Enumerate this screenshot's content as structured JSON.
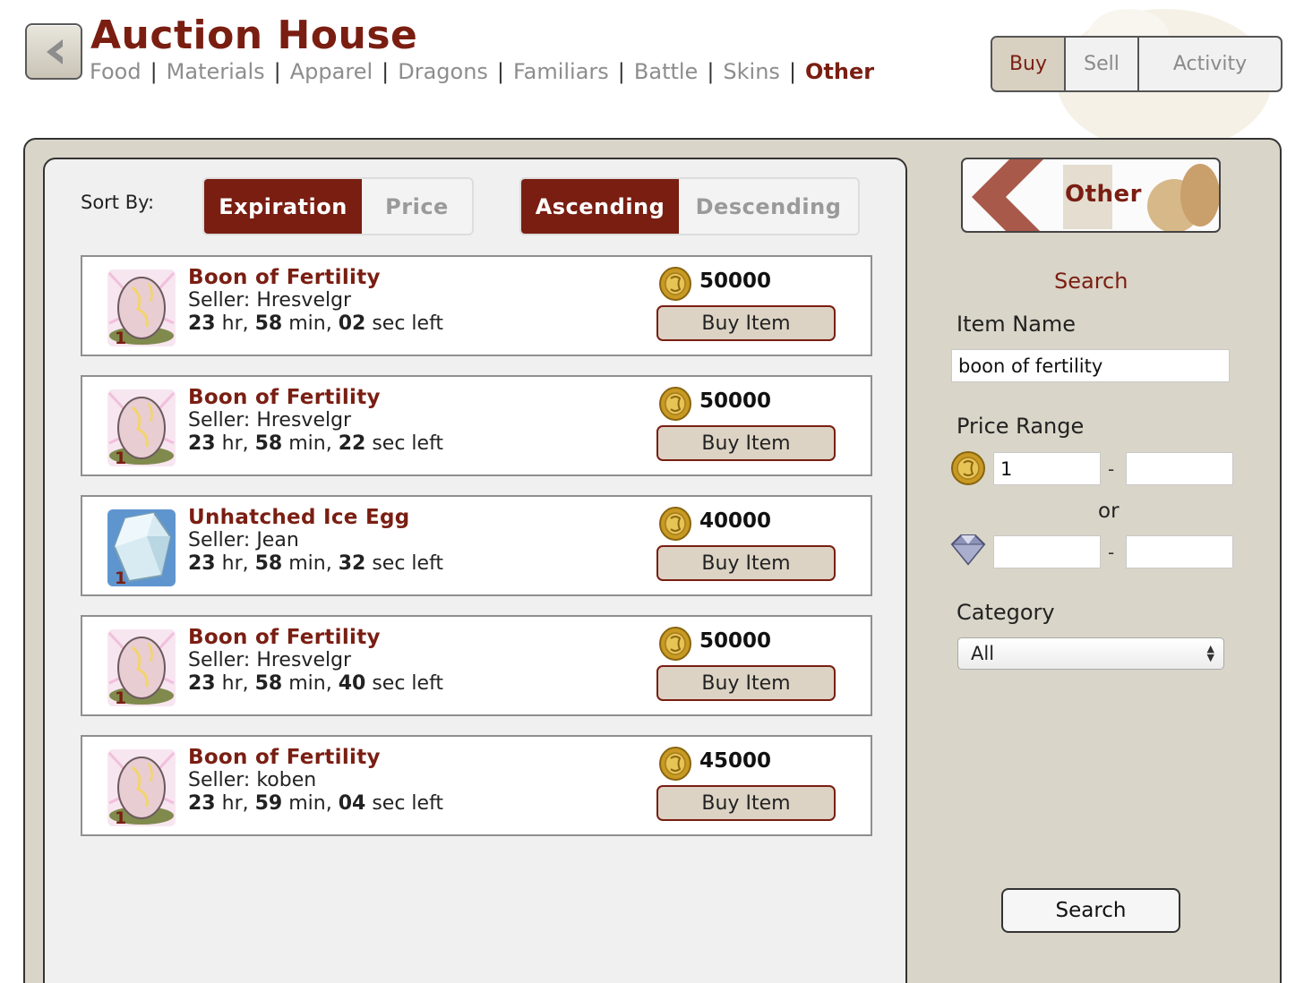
{
  "header": {
    "title": "Auction House",
    "categories": [
      {
        "label": "Food",
        "active": false
      },
      {
        "label": "Materials",
        "active": false
      },
      {
        "label": "Apparel",
        "active": false
      },
      {
        "label": "Dragons",
        "active": false
      },
      {
        "label": "Familiars",
        "active": false
      },
      {
        "label": "Battle",
        "active": false
      },
      {
        "label": "Skins",
        "active": false
      },
      {
        "label": "Other",
        "active": true
      }
    ],
    "separator": "|",
    "modes": [
      {
        "label": "Buy",
        "active": true
      },
      {
        "label": "Sell",
        "active": false
      },
      {
        "label": "Activity",
        "active": false
      }
    ]
  },
  "sort": {
    "label": "Sort By:",
    "field_options": [
      {
        "label": "Expiration",
        "active": true
      },
      {
        "label": "Price",
        "active": false
      }
    ],
    "order_options": [
      {
        "label": "Ascending",
        "active": true
      },
      {
        "label": "Descending",
        "active": false
      }
    ]
  },
  "listings": [
    {
      "name": "Boon of Fertility",
      "seller": "Seller: Hresvelgr",
      "hr": "23",
      "min": "58",
      "sec": "02",
      "price": "50000",
      "qty": "1",
      "icon": "egg-icon",
      "buy_label": "Buy Item"
    },
    {
      "name": "Boon of Fertility",
      "seller": "Seller: Hresvelgr",
      "hr": "23",
      "min": "58",
      "sec": "22",
      "price": "50000",
      "qty": "1",
      "icon": "egg-icon",
      "buy_label": "Buy Item"
    },
    {
      "name": "Unhatched Ice Egg",
      "seller": "Seller: Jean",
      "hr": "23",
      "min": "58",
      "sec": "32",
      "price": "40000",
      "qty": "1",
      "icon": "ice-egg-icon",
      "buy_label": "Buy Item"
    },
    {
      "name": "Boon of Fertility",
      "seller": "Seller: Hresvelgr",
      "hr": "23",
      "min": "58",
      "sec": "40",
      "price": "50000",
      "qty": "1",
      "icon": "egg-icon",
      "buy_label": "Buy Item"
    },
    {
      "name": "Boon of Fertility",
      "seller": "Seller: koben",
      "hr": "23",
      "min": "59",
      "sec": "04",
      "price": "45000",
      "qty": "1",
      "icon": "egg-icon",
      "buy_label": "Buy Item"
    }
  ],
  "time_units": {
    "hr": "hr,",
    "min": "min,",
    "sec": "sec left"
  },
  "sidebar": {
    "category_banner": "Other",
    "search_heading": "Search",
    "item_name_label": "Item Name",
    "item_name_value": "boon of fertility",
    "price_range_label": "Price Range",
    "treasure_min": "1",
    "treasure_max": "",
    "gem_min": "",
    "gem_max": "",
    "dash": "-",
    "or_label": "or",
    "category_label": "Category",
    "category_value": "All",
    "search_button": "Search"
  },
  "colors": {
    "accent": "#7a1e12",
    "frame": "#d9d5c8",
    "button_fill": "#dcd3c4"
  }
}
